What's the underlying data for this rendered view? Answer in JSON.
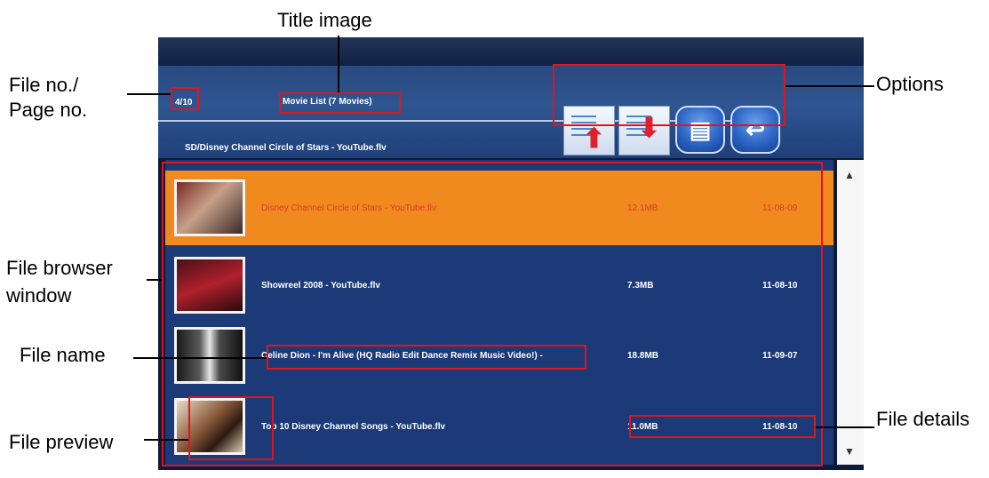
{
  "annotations": {
    "title_image": "Title image",
    "file_page_no_line1": "File no./",
    "file_page_no_line2": "Page no.",
    "options": "Options",
    "file_browser_line1": "File browser",
    "file_browser_line2": "window",
    "file_name": "File name",
    "file_details": "File details",
    "file_preview": "File preview"
  },
  "screen": {
    "page_indicator": "4/10",
    "list_title": "Movie List (7 Movies)",
    "current_path": "SD/Disney Channel Circle of Stars   - YouTube.flv",
    "options": [
      {
        "name": "move-up",
        "icon": "document-up-arrow-icon"
      },
      {
        "name": "move-down",
        "icon": "document-down-arrow-icon"
      },
      {
        "name": "menu",
        "icon": "menu-square-icon"
      },
      {
        "name": "back",
        "icon": "return-arrow-icon"
      }
    ],
    "files": [
      {
        "name": "Disney Channel Circle of Stars   - YouTube.flv",
        "size": "12.1MB",
        "date": "11-08-09",
        "selected": true
      },
      {
        "name": "Showreel 2008   - YouTube.flv",
        "size": "7.3MB",
        "date": "11-08-10",
        "selected": false
      },
      {
        "name": "Celine Dion - I'm Alive (HQ Radio Edit Dance Remix Music Video!) -",
        "size": "18.8MB",
        "date": "11-09-07",
        "selected": false
      },
      {
        "name": "Top 10 Disney Channel Songs   - YouTube.flv",
        "size": "11.0MB",
        "date": "11-08-10",
        "selected": false
      }
    ]
  },
  "colors": {
    "highlight": "#f08a1e",
    "list_bg": "#1c3a78",
    "annotation_red": "#e0141c"
  }
}
